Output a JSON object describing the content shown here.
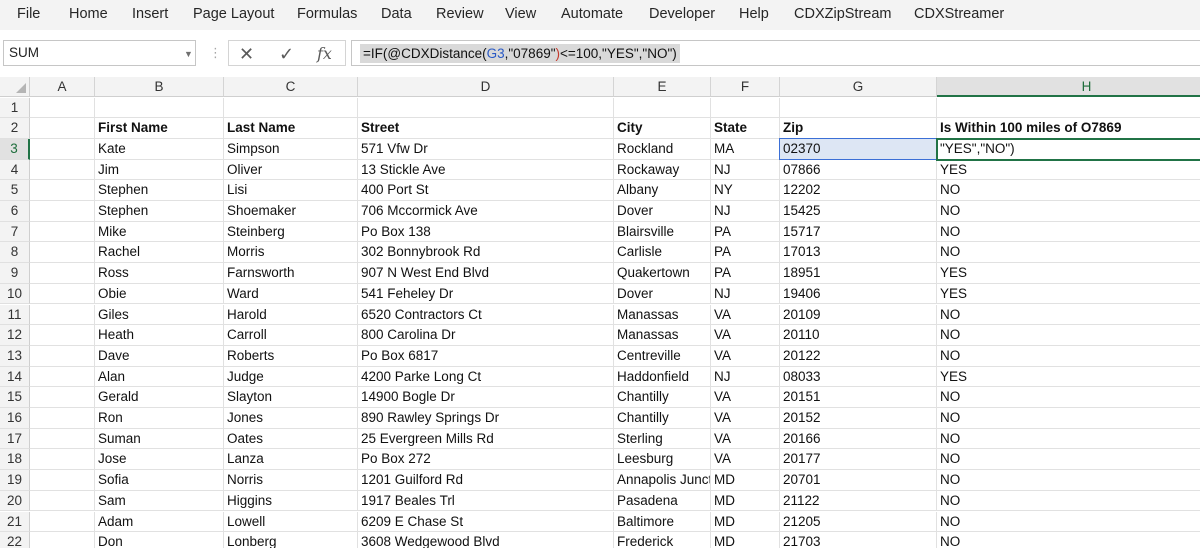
{
  "menu": {
    "items": [
      "File",
      "Home",
      "Insert",
      "Page Layout",
      "Formulas",
      "Data",
      "Review",
      "View",
      "Automate",
      "Developer",
      "Help",
      "CDXZipStream",
      "CDXStreamer"
    ]
  },
  "formula_bar": {
    "name_box": "SUM",
    "cancel_icon": "✕",
    "enter_icon": "✓",
    "fx_icon": "fx",
    "formula": {
      "part1": "=IF(@CDXDistance(",
      "ref": "G3",
      "part2": ",\"07869\"",
      "paren": ")",
      "part3": "<=100,\"YES\",\"NO\")"
    }
  },
  "sheet": {
    "columns": [
      "A",
      "B",
      "C",
      "D",
      "E",
      "F",
      "G",
      "H"
    ],
    "rows": [
      "1",
      "2",
      "3",
      "4",
      "5",
      "6",
      "7",
      "8",
      "9",
      "10",
      "11",
      "12",
      "13",
      "14",
      "15",
      "16",
      "17",
      "18",
      "19",
      "20",
      "21",
      "22"
    ],
    "active_cell": "H3",
    "active_col": "H",
    "active_row": "3",
    "headers": [
      "First Name",
      "Last Name",
      "Street",
      "City",
      "State",
      "Zip",
      "Is Within 100 miles of O7869"
    ],
    "editing_value": "\"YES\",\"NO\")",
    "records": [
      [
        "Kate",
        "Simpson",
        "571 Vfw Dr",
        "Rockland",
        "MA",
        "02370",
        ""
      ],
      [
        "Jim",
        "Oliver",
        "13 Stickle Ave",
        "Rockaway",
        "NJ",
        "07866",
        "YES"
      ],
      [
        "Stephen",
        "Lisi",
        "400 Port St",
        "Albany",
        "NY",
        "12202",
        "NO"
      ],
      [
        "Stephen",
        "Shoemaker",
        "706 Mccormick Ave",
        "Dover",
        "NJ",
        "15425",
        "NO"
      ],
      [
        "Mike",
        "Steinberg",
        "Po Box 138",
        "Blairsville",
        "PA",
        "15717",
        "NO"
      ],
      [
        "Rachel",
        "Morris",
        "302 Bonnybrook Rd",
        "Carlisle",
        "PA",
        "17013",
        "NO"
      ],
      [
        "Ross",
        "Farnsworth",
        "907 N West End Blvd",
        "Quakertown",
        "PA",
        "18951",
        "YES"
      ],
      [
        "Obie",
        "Ward",
        "541 Feheley Dr",
        "Dover",
        "NJ",
        "19406",
        "YES"
      ],
      [
        "Giles",
        "Harold",
        "6520 Contractors Ct",
        "Manassas",
        "VA",
        "20109",
        "NO"
      ],
      [
        "Heath",
        "Carroll",
        "800 Carolina Dr",
        "Manassas",
        "VA",
        "20110",
        "NO"
      ],
      [
        "Dave",
        "Roberts",
        "Po Box 6817",
        "Centreville",
        "VA",
        "20122",
        "NO"
      ],
      [
        "Alan",
        "Judge",
        "4200 Parke Long Ct",
        "Haddonfield",
        "NJ",
        "08033",
        "YES"
      ],
      [
        "Gerald",
        "Slayton",
        "14900 Bogle Dr",
        "Chantilly",
        "VA",
        "20151",
        "NO"
      ],
      [
        "Ron",
        "Jones",
        "890 Rawley Springs Dr",
        "Chantilly",
        "VA",
        "20152",
        "NO"
      ],
      [
        "Suman",
        "Oates",
        "25 Evergreen Mills Rd",
        "Sterling",
        "VA",
        "20166",
        "NO"
      ],
      [
        "Jose",
        "Lanza",
        "Po Box 272",
        "Leesburg",
        "VA",
        "20177",
        "NO"
      ],
      [
        "Sofia",
        "Norris",
        "1201 Guilford Rd",
        "Annapolis Junct",
        "MD",
        "20701",
        "NO"
      ],
      [
        "Sam",
        "Higgins",
        "1917 Beales Trl",
        "Pasadena",
        "MD",
        "21122",
        "NO"
      ],
      [
        "Adam",
        "Lowell",
        "6209 E Chase St",
        "Baltimore",
        "MD",
        "21205",
        "NO"
      ],
      [
        "Don",
        "Lonberg",
        "3608 Wedgewood Blvd",
        "Frederick",
        "MD",
        "21703",
        "NO"
      ]
    ]
  },
  "colors": {
    "excel_green": "#217346",
    "ref_blue": "#2a5ac5",
    "paren_red": "#c5392c"
  }
}
